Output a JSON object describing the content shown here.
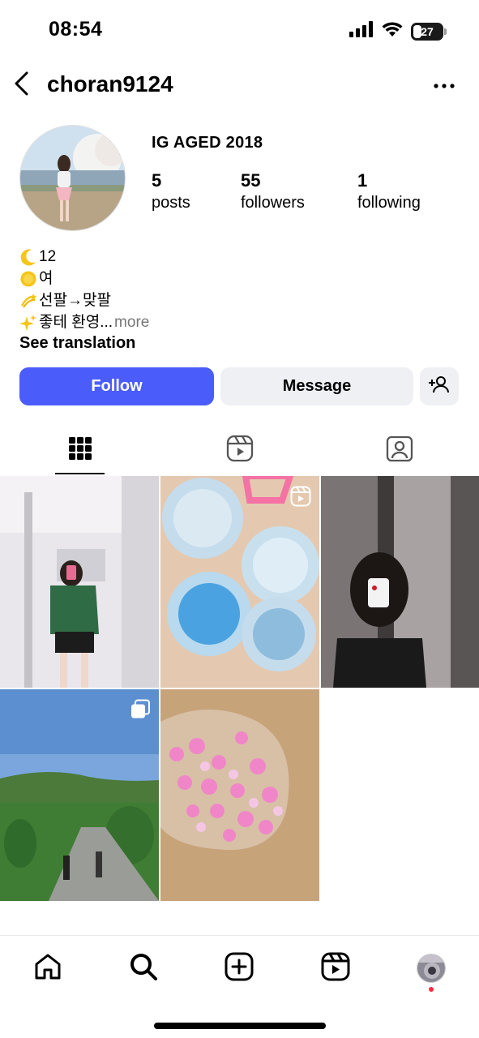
{
  "status_bar": {
    "time": "08:54",
    "battery_level": "27"
  },
  "header": {
    "username": "choran9124"
  },
  "profile": {
    "bio_title": "IG AGED 2018",
    "stats": [
      {
        "count": "5",
        "label": "posts"
      },
      {
        "count": "55",
        "label": "followers"
      },
      {
        "count": "1",
        "label": "following"
      }
    ],
    "bio_lines": [
      "12",
      "여",
      "선팔→맞팔",
      "좋테 환영..."
    ],
    "more_label": "more",
    "see_translation": "See translation"
  },
  "actions": {
    "follow_label": "Follow",
    "message_label": "Message"
  },
  "icons": {
    "back": "chevron-left-icon",
    "more": "more-horizontal-icon",
    "grid": "grid-icon",
    "reels": "reels-icon",
    "tagged": "tagged-icon",
    "home": "home-icon",
    "search": "search-icon",
    "create": "create-icon",
    "add_user": "add-user-icon"
  },
  "colors": {
    "accent": "#4a5dfa",
    "secondary_button": "#eef0f4",
    "notification_dot": "#ff2b3b"
  },
  "posts": [
    {
      "type": "photo"
    },
    {
      "type": "reel"
    },
    {
      "type": "photo"
    },
    {
      "type": "carousel"
    },
    {
      "type": "photo"
    }
  ]
}
